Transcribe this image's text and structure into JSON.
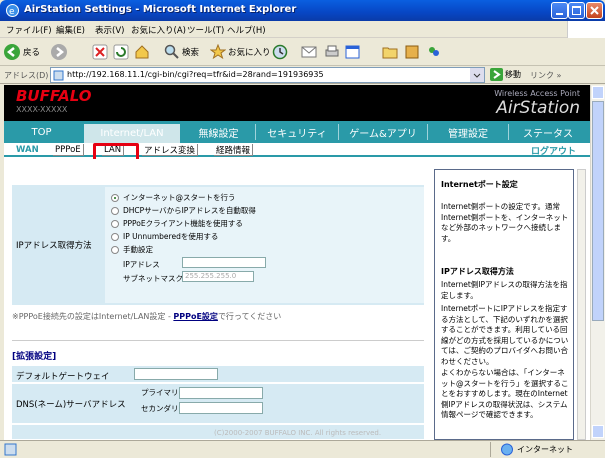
{
  "window": {
    "title": "AirStation Settings - Microsoft Internet Explorer"
  },
  "menu": [
    "ファイル(F)",
    "編集(E)",
    "表示(V)",
    "お気に入り(A)",
    "ツール(T)",
    "ヘルプ(H)"
  ],
  "toolbar": {
    "back": "戻る",
    "search": "検索",
    "favorites": "お気に入り"
  },
  "address": {
    "label": "アドレス(D)",
    "url": "http://192.168.11.1/cgi-bin/cgi?req=tfr&id=28rand=191936935",
    "go": "移動",
    "links": "リンク »"
  },
  "brand": {
    "logo": "BUFFALO",
    "model": "XXXX-XXXXX",
    "tagline": "Wireless Access Point",
    "name": "AirStation"
  },
  "tabs": [
    "TOP",
    "Internet/LAN",
    "無線設定",
    "セキュリティ",
    "ゲーム&アプリ",
    "管理設定",
    "ステータス"
  ],
  "subtabs": [
    "WAN",
    "PPPoE",
    "LAN",
    "アドレス変換",
    "経路情報"
  ],
  "logout": "ログアウト",
  "ip_section": {
    "label": "IPアドレス取得方法",
    "options": [
      "インターネット@スタートを行う",
      "DHCPサーバからIPアドレスを自動取得",
      "PPPoEクライアント機能を使用する",
      "IP Unnumberedを使用する",
      "手動設定"
    ],
    "ip_label": "IPアドレス",
    "subnet_label": "サブネットマスク",
    "subnet_value": "255.255.255.0"
  },
  "pppoe_note": {
    "text": "※PPPoE接続先の設定はInternet/LAN設定 - ",
    "link": "PPPoE設定",
    "tail": "で行ってください"
  },
  "extended": {
    "title": "[拡張設定]",
    "gateway": "デフォルトゲートウェイ",
    "dns": "DNS(ネーム)サーバアドレス",
    "primary": "プライマリ:",
    "secondary": "セカンダリ:"
  },
  "copyright": "(C)2000-2007 BUFFALO INC. All rights reserved.",
  "help": {
    "h1": "Internetポート設定",
    "p1": "Internet側ポートの設定です。通常Internet側ポートを、インターネットなど外部のネットワークへ接続します。",
    "h2": "IPアドレス取得方法",
    "p2a": "Internet側IPアドレスの取得方法を指定します。",
    "p2b": "InternetポートにIPアドレスを指定する方法として、下記のいずれかを選択することができます。利用している回線がどの方式を採用しているかについては、ご契約のプロバイダへお問い合わせください。",
    "p2c": "よくわからない場合は、「インターネット@スタートを行う」を選択することをおすすめします。現在のInternet側IPアドレスの取得状況は、システム情報ページで確認できます。"
  },
  "status": {
    "zone": "インターネット"
  }
}
